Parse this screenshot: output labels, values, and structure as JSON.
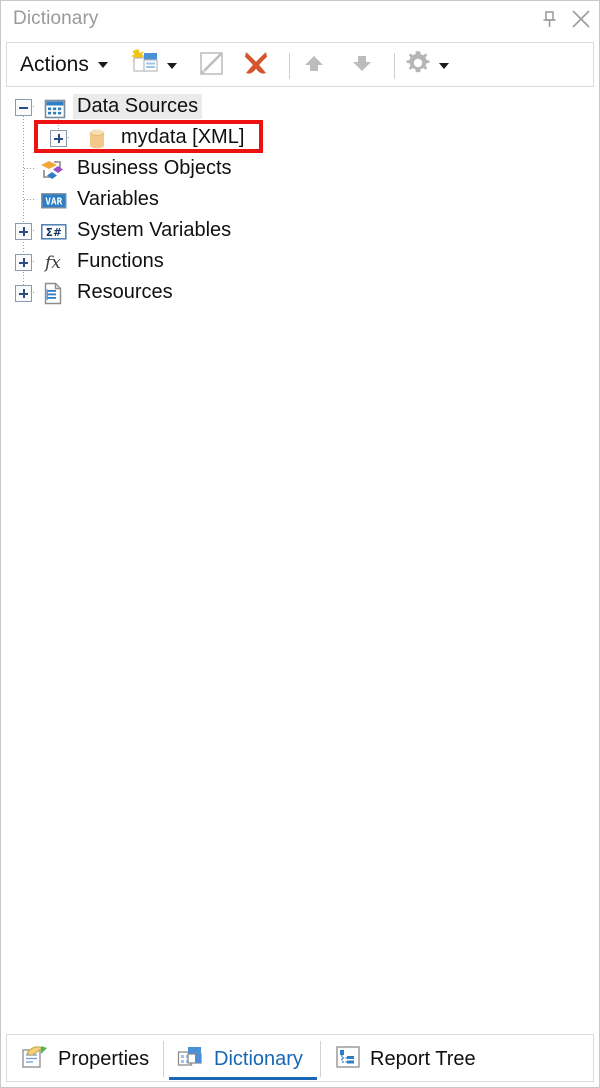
{
  "window": {
    "title": "Dictionary",
    "pin_icon": "pin-icon",
    "close_icon": "close-icon"
  },
  "toolbar": {
    "actions_label": "Actions",
    "items": [
      {
        "name": "new-item-button",
        "icon": "new-data-source-icon",
        "has_caret": true,
        "enabled": true
      },
      {
        "name": "edit-button",
        "icon": "edit-pencil-icon",
        "has_caret": false,
        "enabled": false
      },
      {
        "name": "delete-button",
        "icon": "delete-x-icon",
        "has_caret": false,
        "enabled": true
      },
      {
        "name": "move-up-button",
        "icon": "arrow-up-icon",
        "has_caret": false,
        "enabled": false
      },
      {
        "name": "move-down-button",
        "icon": "arrow-down-icon",
        "has_caret": false,
        "enabled": false
      },
      {
        "name": "settings-button",
        "icon": "gear-icon",
        "has_caret": true,
        "enabled": true
      }
    ]
  },
  "tree": {
    "nodes": [
      {
        "label": "Data Sources",
        "icon": "data-sources-table-icon",
        "expander": "minus",
        "selected": true,
        "highlighted": false,
        "indent": 0
      },
      {
        "label": "mydata [XML]",
        "icon": "xml-database-cylinder-icon",
        "expander": "plus",
        "selected": false,
        "highlighted": true,
        "indent": 1
      },
      {
        "label": "Business Objects",
        "icon": "business-objects-icon",
        "expander": "none",
        "selected": false,
        "highlighted": false,
        "indent": 0
      },
      {
        "label": "Variables",
        "icon": "variables-var-icon",
        "expander": "none",
        "selected": false,
        "highlighted": false,
        "indent": 0
      },
      {
        "label": "System Variables",
        "icon": "system-variables-sigma-icon",
        "expander": "plus",
        "selected": false,
        "highlighted": false,
        "indent": 0
      },
      {
        "label": "Functions",
        "icon": "functions-fx-icon",
        "expander": "plus",
        "selected": false,
        "highlighted": false,
        "indent": 0
      },
      {
        "label": "Resources",
        "icon": "resources-document-icon",
        "expander": "plus",
        "selected": false,
        "highlighted": false,
        "indent": 0
      }
    ]
  },
  "tabs": [
    {
      "label": "Properties",
      "icon": "properties-icon",
      "active": false
    },
    {
      "label": "Dictionary",
      "icon": "dictionary-icon",
      "active": true
    },
    {
      "label": "Report Tree",
      "icon": "report-tree-icon",
      "active": false
    }
  ],
  "colors": {
    "accent": "#1866b4",
    "highlight": "#ee1111",
    "selection": "#ebebeb",
    "title_text": "#9a9a9a",
    "delete_x": "#d4562f",
    "cylinder": "#f0c175"
  }
}
